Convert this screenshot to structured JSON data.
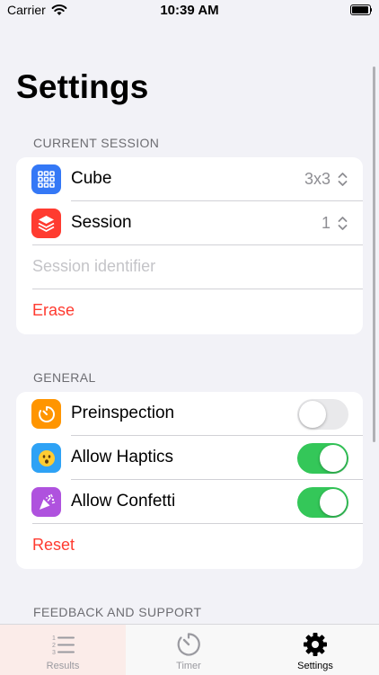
{
  "status_bar": {
    "carrier": "Carrier",
    "time": "10:39 AM"
  },
  "page_title": "Settings",
  "current_session": {
    "header": "CURRENT SESSION",
    "cube_label": "Cube",
    "cube_value": "3x3",
    "session_label": "Session",
    "session_value": "1",
    "identifier_placeholder": "Session identifier",
    "erase_label": "Erase"
  },
  "general": {
    "header": "GENERAL",
    "toggles": [
      {
        "label": "Preinspection",
        "on": false
      },
      {
        "label": "Allow Haptics",
        "on": true
      },
      {
        "label": "Allow Confetti",
        "on": true
      }
    ],
    "reset_label": "Reset"
  },
  "feedback": {
    "header": "FEEDBACK AND SUPPORT"
  },
  "tabs": [
    {
      "label": "Results",
      "active": false
    },
    {
      "label": "Timer",
      "active": false
    },
    {
      "label": "Settings",
      "active": true
    }
  ],
  "colors": {
    "cube_icon_bg": "#3478f6",
    "session_icon_bg": "#ff3b30",
    "preinspection_icon_bg": "#ff9500",
    "haptics_icon_bg": "#2ea2f5",
    "confetti_icon_bg": "#af52de",
    "toggle_on": "#34c759",
    "destructive": "#ff3b30"
  }
}
